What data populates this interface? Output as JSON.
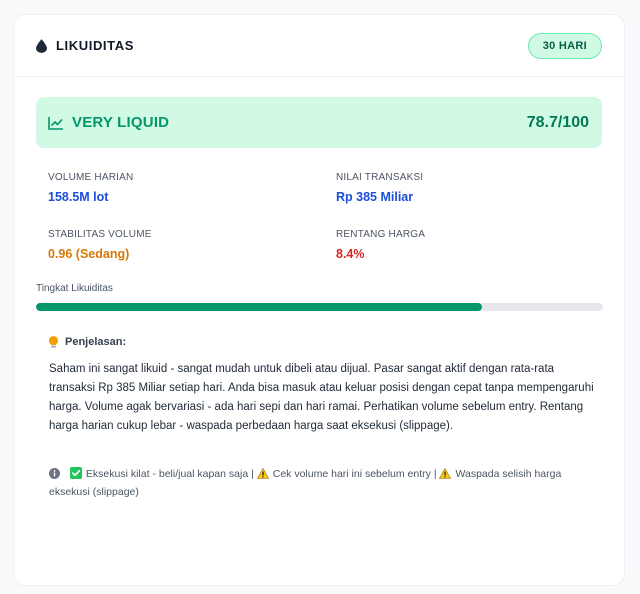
{
  "header": {
    "title": "LIKUIDITAS",
    "icon": "water-drop-icon",
    "period_badge": "30 HARI"
  },
  "status": {
    "icon": "trending-up-icon",
    "label": "VERY LIQUID",
    "score": "78.7/100",
    "color": "#059669",
    "background": "#d1fae5"
  },
  "metrics": [
    {
      "label": "VOLUME HARIAN",
      "value": "158.5M lot",
      "color": "#1d4ed8"
    },
    {
      "label": "NILAI TRANSAKSI",
      "value": "Rp 385 Miliar",
      "color": "#1d4ed8"
    },
    {
      "label": "STABILITAS VOLUME",
      "value": "0.96 (Sedang)",
      "color": "#d97706"
    },
    {
      "label": "RENTANG HARGA",
      "value": "8.4%",
      "color": "#dc2626"
    }
  ],
  "progress": {
    "label": "Tingkat Likuiditas",
    "value_percent": 78.7,
    "color": "#059669"
  },
  "explanation": {
    "icon": "lightbulb-icon",
    "title": "Penjelasan:",
    "text": "Saham ini sangat likuid - sangat mudah untuk dibeli atau dijual. Pasar sangat aktif dengan rata-rata transaksi Rp 385 Miliar setiap hari. Anda bisa masuk atau keluar posisi dengan cepat tanpa mempengaruhi harga. Volume agak bervariasi - ada hari sepi dan hari ramai. Perhatikan volume sebelum entry. Rentang harga harian cukup lebar - waspada perbedaan harga saat eksekusi (slippage)."
  },
  "footer": {
    "info_icon": "info-icon",
    "items": [
      {
        "icon": "check-mark-icon",
        "text": "Eksekusi kilat - beli/jual kapan saja |"
      },
      {
        "icon": "warning-icon",
        "text": "Cek volume hari ini sebelum entry |"
      },
      {
        "icon": "warning-icon",
        "text": "Waspada selisih harga eksekusi (slippage)"
      }
    ]
  }
}
